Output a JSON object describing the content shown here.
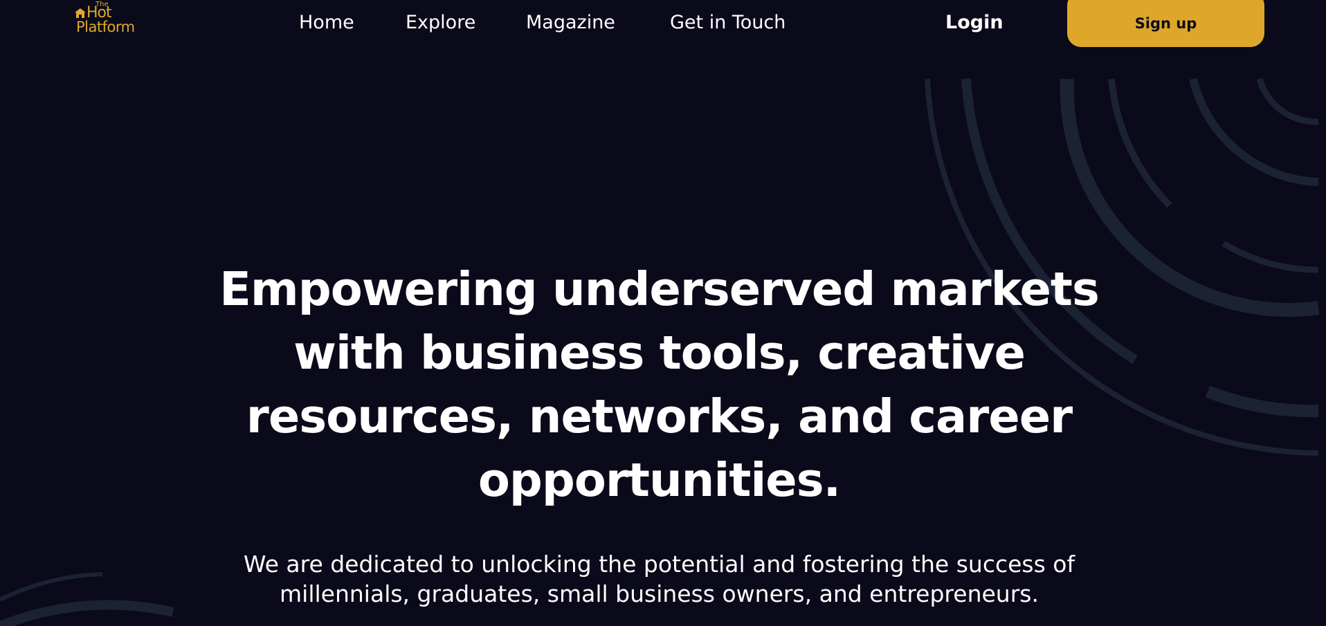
{
  "brand": {
    "logo_text_small": "The",
    "logo_text_main": "Hot",
    "logo_text_sub": "Platform",
    "logo_color": "#e0a92a"
  },
  "nav": {
    "links": [
      {
        "label": "Home"
      },
      {
        "label": "Explore"
      },
      {
        "label": "Magazine"
      },
      {
        "label": "Get in Touch"
      }
    ],
    "login_label": "Login",
    "signup_label": "Sign up"
  },
  "hero": {
    "title": "Empowering underserved markets with business tools, creative resources, networks, and career opportunities.",
    "subtitle": "We are dedicated to unlocking the potential and fostering the success of millennials, graduates, small business owners, and entrepreneurs."
  },
  "theme": {
    "background": "#0a0a1a",
    "accent": "#dfa72a",
    "text": "#ffffff",
    "decor_arc": "#1b2234"
  },
  "icons": {
    "logo_house": "house-icon"
  }
}
